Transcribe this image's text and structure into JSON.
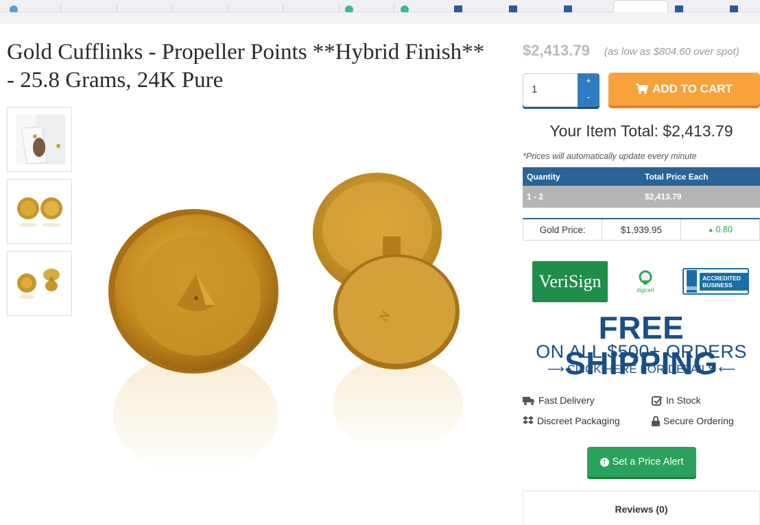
{
  "product": {
    "title": "Gold Cufflinks - Propeller Points **Hybrid Finish** - 25.8 Grams, 24K Pure"
  },
  "thumbnails": [
    {
      "name": "thumb-worn-on-cuff"
    },
    {
      "name": "thumb-front-pair"
    },
    {
      "name": "thumb-side-pair"
    }
  ],
  "purchase": {
    "price": "$2,413.79",
    "as_low_as": "(as low as $804.60 over spot)",
    "quantity": "1",
    "plus": "+",
    "minus": "-",
    "add_to_cart": "ADD TO CART",
    "item_total": "Your Item Total: $2,413.79",
    "update_note": "*Prices will automatically update every minute"
  },
  "price_table": {
    "headers": [
      "Quantity",
      "Total Price Each"
    ],
    "rows": [
      [
        "1 - 2",
        "$2,413.79"
      ]
    ]
  },
  "gold_price": {
    "label": "Gold Price:",
    "value": "$1,939.95",
    "change": "0.80",
    "change_color": "#2aa84a"
  },
  "trust": {
    "verisign": "VeriSign",
    "digicert": "digicert",
    "bbb_label": "BBB",
    "bbb_text": "ACCREDITED BUSINESS"
  },
  "shipping": {
    "line1": "FREE SHIPPING",
    "line2": "ON ALL $500+ ORDERS",
    "line3": "CLICK HERE FOR DETAILS"
  },
  "features": [
    {
      "label": "Fast Delivery",
      "icon": "truck-icon"
    },
    {
      "label": "In Stock",
      "icon": "checkbox-icon"
    },
    {
      "label": "Discreet Packaging",
      "icon": "dropbox-icon"
    },
    {
      "label": "Secure Ordering",
      "icon": "lock-icon"
    }
  ],
  "price_alert": {
    "label": "Set a Price Alert"
  },
  "reviews": {
    "label": "Reviews (0)"
  },
  "colors": {
    "accent_blue": "#2a6496",
    "cart_orange": "#f7a23b",
    "alert_green": "#2ba25b",
    "shipping_blue": "#1a4f86"
  }
}
